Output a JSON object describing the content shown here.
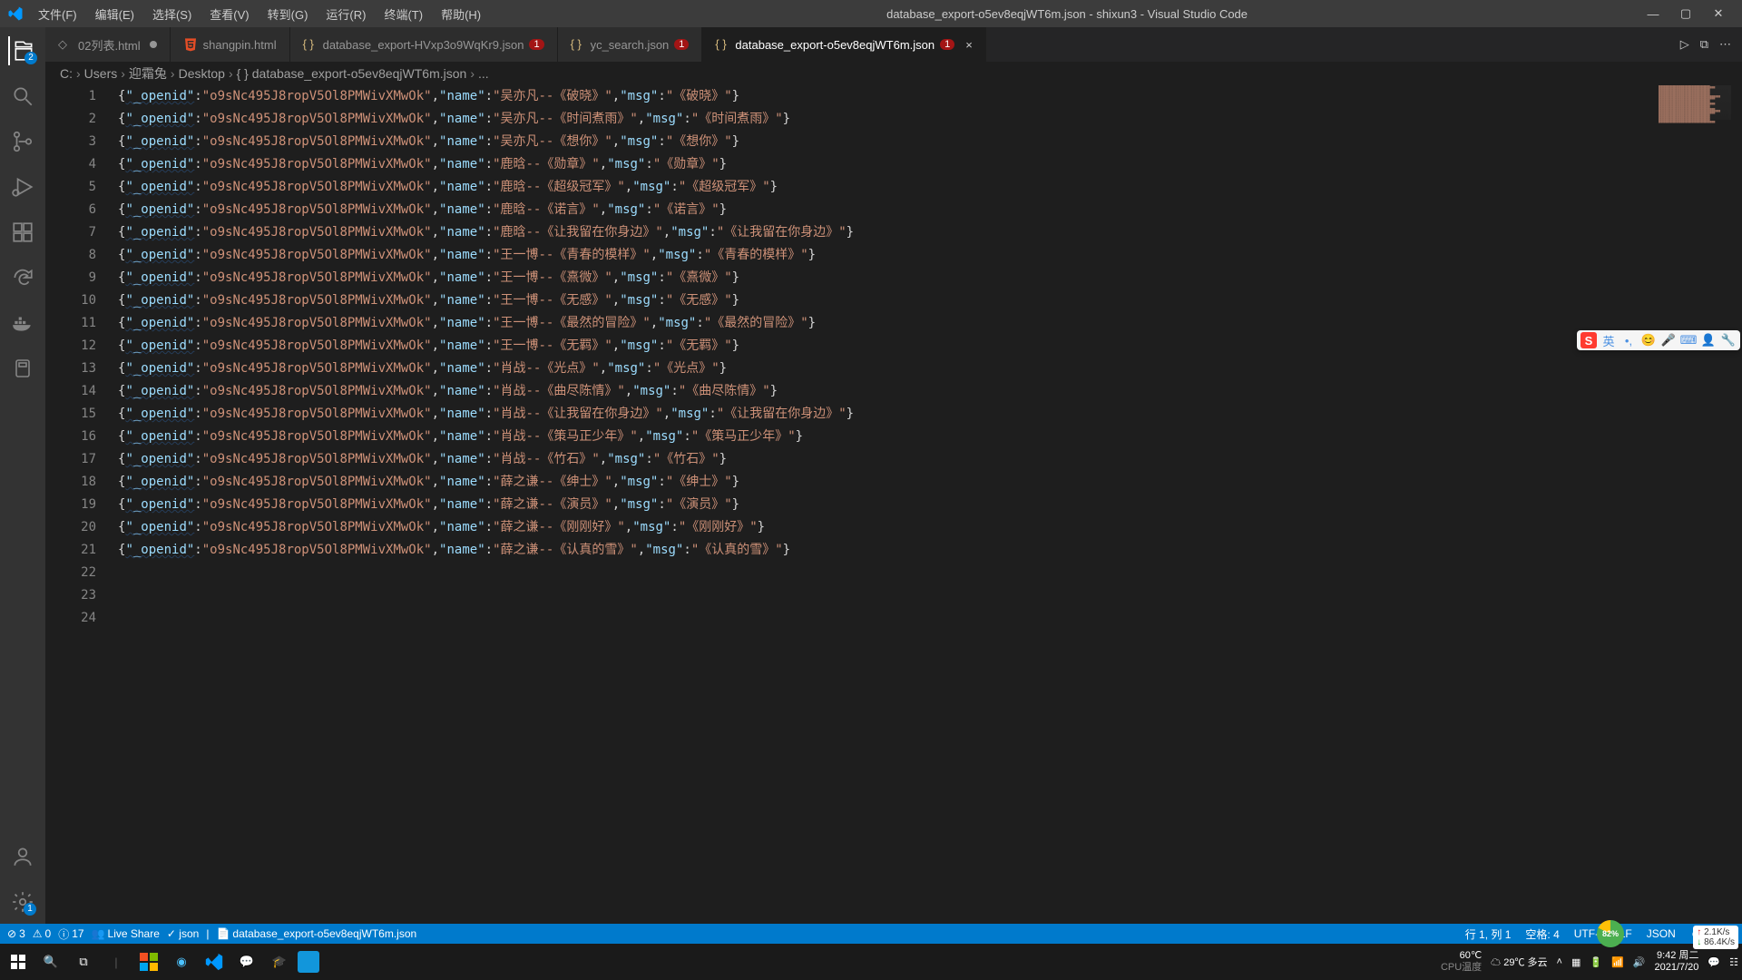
{
  "title": "database_export-o5ev8eqjWT6m.json - shixun3 - Visual Studio Code",
  "menu": [
    "文件(F)",
    "编辑(E)",
    "选择(S)",
    "查看(V)",
    "转到(G)",
    "运行(R)",
    "终端(T)",
    "帮助(H)"
  ],
  "activity_badges": {
    "explorer": "2",
    "settings": "1"
  },
  "tabs": [
    {
      "label": "02列表.html",
      "icon": "html",
      "modified": true,
      "badge": "",
      "active": false
    },
    {
      "label": "shangpin.html",
      "icon": "html5",
      "modified": false,
      "badge": "",
      "active": false
    },
    {
      "label": "database_export-HVxp3o9WqKr9.json",
      "icon": "json",
      "modified": false,
      "badge": "1",
      "active": false
    },
    {
      "label": "yc_search.json",
      "icon": "json",
      "modified": false,
      "badge": "1",
      "active": false
    },
    {
      "label": "database_export-o5ev8eqjWT6m.json",
      "icon": "json",
      "modified": false,
      "badge": "1",
      "active": true
    }
  ],
  "breadcrumbs": [
    "C:",
    "Users",
    "迎霜兔",
    "Desktop",
    "{ }  database_export-o5ev8eqjWT6m.json",
    "..."
  ],
  "lines": [
    {
      "openid": "o9sNc495J8ropV5Ol8PMWivXMwOk",
      "nm": "吴亦凡--《破晓》",
      "msg": "《破晓》"
    },
    {
      "openid": "o9sNc495J8ropV5Ol8PMWivXMwOk",
      "nm": "吴亦凡--《时间煮雨》",
      "msg": "《时间煮雨》"
    },
    {
      "openid": "o9sNc495J8ropV5Ol8PMWivXMwOk",
      "nm": "吴亦凡--《想你》",
      "msg": "《想你》"
    },
    {
      "openid": "o9sNc495J8ropV5Ol8PMWivXMwOk",
      "nm": "鹿晗--《勋章》",
      "msg": "《勋章》"
    },
    {
      "openid": "o9sNc495J8ropV5Ol8PMWivXMwOk",
      "nm": "鹿晗--《超级冠军》",
      "msg": "《超级冠军》"
    },
    {
      "openid": "o9sNc495J8ropV5Ol8PMWivXMwOk",
      "nm": "鹿晗--《诺言》",
      "msg": "《诺言》"
    },
    {
      "openid": "o9sNc495J8ropV5Ol8PMWivXMwOk",
      "nm": "鹿晗--《让我留在你身边》",
      "msg": "《让我留在你身边》"
    },
    {
      "openid": "o9sNc495J8ropV5Ol8PMWivXMwOk",
      "nm": "王一博--《青春的模样》",
      "msg": "《青春的模样》"
    },
    {
      "openid": "o9sNc495J8ropV5Ol8PMWivXMwOk",
      "nm": "王一博--《熹微》",
      "msg": "《熹微》"
    },
    {
      "openid": "o9sNc495J8ropV5Ol8PMWivXMwOk",
      "nm": "王一博--《无感》",
      "msg": "《无感》"
    },
    {
      "openid": "o9sNc495J8ropV5Ol8PMWivXMwOk",
      "nm": "王一博--《最然的冒险》",
      "msg": "《最然的冒险》"
    },
    {
      "openid": "o9sNc495J8ropV5Ol8PMWivXMwOk",
      "nm": "王一博--《无羁》",
      "msg": "《无羁》"
    },
    {
      "openid": "o9sNc495J8ropV5Ol8PMWivXMwOk",
      "nm": "肖战--《光点》",
      "msg": "《光点》"
    },
    {
      "openid": "o9sNc495J8ropV5Ol8PMWivXMwOk",
      "nm": "肖战--《曲尽陈情》",
      "msg": "《曲尽陈情》"
    },
    {
      "openid": "o9sNc495J8ropV5Ol8PMWivXMwOk",
      "nm": "肖战--《让我留在你身边》",
      "msg": "《让我留在你身边》"
    },
    {
      "openid": "o9sNc495J8ropV5Ol8PMWivXMwOk",
      "nm": "肖战--《策马正少年》",
      "msg": "《策马正少年》"
    },
    {
      "openid": "o9sNc495J8ropV5Ol8PMWivXMwOk",
      "nm": "肖战--《竹石》",
      "msg": "《竹石》"
    },
    {
      "openid": "o9sNc495J8ropV5Ol8PMWivXMwOk",
      "nm": "薛之谦--《绅士》",
      "msg": "《绅士》"
    },
    {
      "openid": "o9sNc495J8ropV5Ol8PMWivXMwOk",
      "nm": "薛之谦--《演员》",
      "msg": "《演员》"
    },
    {
      "openid": "o9sNc495J8ropV5Ol8PMWivXMwOk",
      "nm": "薛之谦--《刚刚好》",
      "msg": "《刚刚好》"
    },
    {
      "openid": "o9sNc495J8ropV5Ol8PMWivXMwOk",
      "nm": "薛之谦--《认真的雪》",
      "msg": "《认真的雪》"
    }
  ],
  "extra_blank_lines": [
    22,
    23,
    24
  ],
  "status": {
    "errors": "3",
    "warnings": "0",
    "infos": "17",
    "liveshare": "Live Share",
    "lang_check": "✓ json",
    "lang_sep": "|",
    "filename": "database_export-o5ev8eqjWT6m.json",
    "pos": "行 1, 列 1",
    "spaces": "空格: 4",
    "encoding": "UTF-8",
    "eol": "LF",
    "lang": "JSON"
  },
  "tray": {
    "cpu_temp": "60℃",
    "cpu_label": "CPU温度",
    "weather": "29℃ 多云",
    "time": "9:42 周二",
    "date": "2021/7/20"
  },
  "gauge": "82%",
  "net": {
    "up": "2.1K/s",
    "dn": "86.4K/s"
  }
}
